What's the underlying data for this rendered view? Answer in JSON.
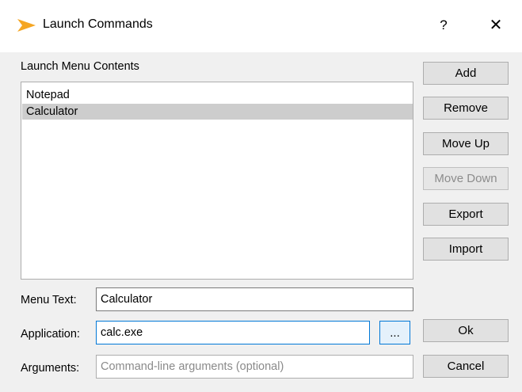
{
  "window": {
    "title": "Launch Commands",
    "help_label": "?",
    "close_label": "✕",
    "accent_color": "#f5a623"
  },
  "list": {
    "heading": "Launch Menu Contents",
    "items": [
      {
        "label": "Notepad",
        "selected": false
      },
      {
        "label": "Calculator",
        "selected": true
      }
    ]
  },
  "side_buttons": {
    "add": "Add",
    "remove": "Remove",
    "move_up": "Move Up",
    "move_down": "Move Down",
    "export": "Export",
    "import": "Import"
  },
  "form": {
    "menu_text_label": "Menu Text:",
    "menu_text_value": "Calculator",
    "application_label": "Application:",
    "application_value": "calc.exe",
    "browse_label": "...",
    "arguments_label": "Arguments:",
    "arguments_value": "",
    "arguments_placeholder": "Command-line arguments (optional)"
  },
  "dialog_buttons": {
    "ok": "Ok",
    "cancel": "Cancel"
  }
}
